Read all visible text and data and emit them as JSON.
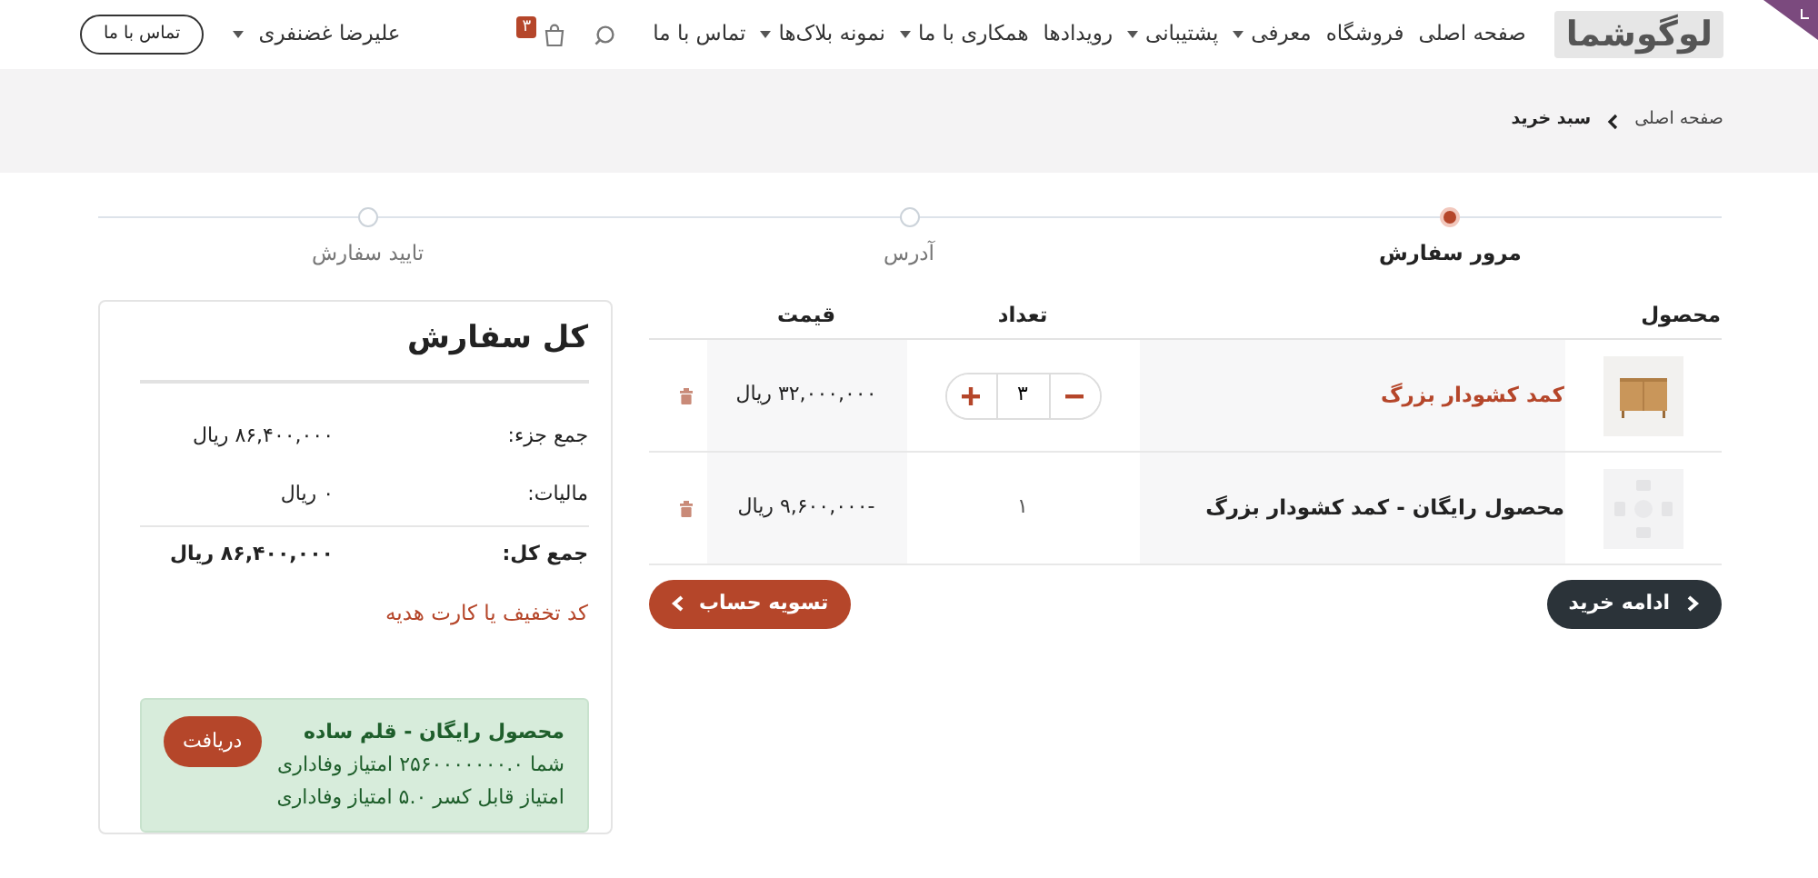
{
  "navbar": {
    "logo": "لوگوشما",
    "items": [
      {
        "label": "صفحه اصلی",
        "dropdown": false
      },
      {
        "label": "فروشگاه",
        "dropdown": false
      },
      {
        "label": "معرفی",
        "dropdown": true
      },
      {
        "label": "پشتیبانی",
        "dropdown": true
      },
      {
        "label": "رویدادها",
        "dropdown": false
      },
      {
        "label": "همکاری با ما",
        "dropdown": true
      },
      {
        "label": "نمونه بلاک‌ها",
        "dropdown": true
      },
      {
        "label": "تماس با ما",
        "dropdown": false
      }
    ],
    "cart_count": "۳",
    "user": "علیرضا غضنفری",
    "contact_button": "تماس با ما"
  },
  "breadcrumb": [
    {
      "label": "صفحه اصلی",
      "current": false
    },
    {
      "label": "سبد خرید",
      "current": true
    }
  ],
  "steps": [
    {
      "label": "مرور سفارش",
      "selected": true
    },
    {
      "label": "آدرس",
      "selected": false
    },
    {
      "label": "تایید سفارش",
      "selected": false
    }
  ],
  "cart": {
    "columns": [
      "محصول",
      "تعداد",
      "قیمت"
    ],
    "rows": [
      {
        "kind": "product",
        "name": "کمد کشودار بزرگ",
        "quantity": "۳",
        "price": "۳۲,۰۰۰,۰۰۰ ریال"
      },
      {
        "kind": "reward",
        "name": "محصول رایگان - کمد کشودار بزرگ",
        "quantity": "۱",
        "price": "-۹,۶۰۰,۰۰۰ ریال"
      }
    ],
    "continue_button": "ادامه خرید",
    "checkout_button": "تسویه حساب"
  },
  "summary": {
    "title": "کل سفارش",
    "lines": [
      {
        "label": "جمع جزء:",
        "value": "۸۶,۴۰۰,۰۰۰ ریال",
        "bold": false
      },
      {
        "label": "مالیات:",
        "value": "۰ ریال",
        "bold": false
      },
      {
        "label": "جمع کل:",
        "value": "۸۶,۴۰۰,۰۰۰ ریال",
        "bold": true
      }
    ],
    "coupon_link": "کد تخفیف یا کارت هدیه",
    "reward": {
      "title": "محصول رایگان - قلم ساده",
      "lines": [
        "شما ۲۵۶۰۰۰۰۰۰۰.۰ امتیاز وفاداری",
        "امتیاز قابل کسر ۵.۰ امتیاز وفاداری"
      ],
      "button": "دریافت"
    }
  }
}
